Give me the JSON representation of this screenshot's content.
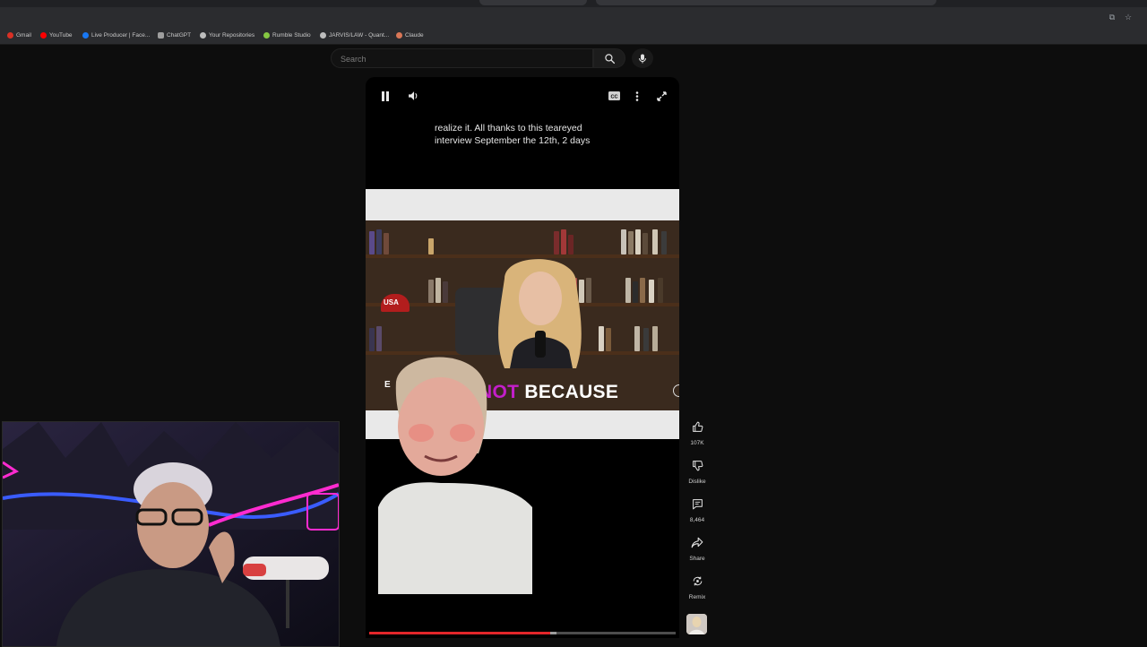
{
  "browser": {
    "bookmarks": [
      {
        "label": "Gmail",
        "color": "#d93025"
      },
      {
        "label": "YouTube",
        "color": "#ff0000"
      },
      {
        "label": "Live Producer | Face...",
        "color": "#1877f2"
      },
      {
        "label": "ChatGPT",
        "color": "#9e9e9e"
      },
      {
        "label": "Your Repositories",
        "color": "#bdbdbd"
      },
      {
        "label": "Rumble Studio",
        "color": "#85c742"
      },
      {
        "label": "JARVIS/LAW - Quant...",
        "color": "#bdbdbd"
      },
      {
        "label": "Claude",
        "color": "#d97757"
      }
    ]
  },
  "search": {
    "placeholder": "Search"
  },
  "player": {
    "caption_line1": "realize it. All thanks to this teareyed",
    "caption_line2": "interview September the 12th, 2 days",
    "overlay_word1": "NOT",
    "overlay_word2": "BECAUSE",
    "overlay_fragment": "E",
    "hat_text": "USA",
    "progress": 0.59,
    "buffered": 0.61
  },
  "actions": {
    "like_count": "107K",
    "dislike_label": "Dislike",
    "comment_count": "8,464",
    "share_label": "Share",
    "remix_label": "Remix"
  },
  "colors": {
    "accent_red": "#e3262a",
    "overlay_magenta": "#c31fc9"
  }
}
